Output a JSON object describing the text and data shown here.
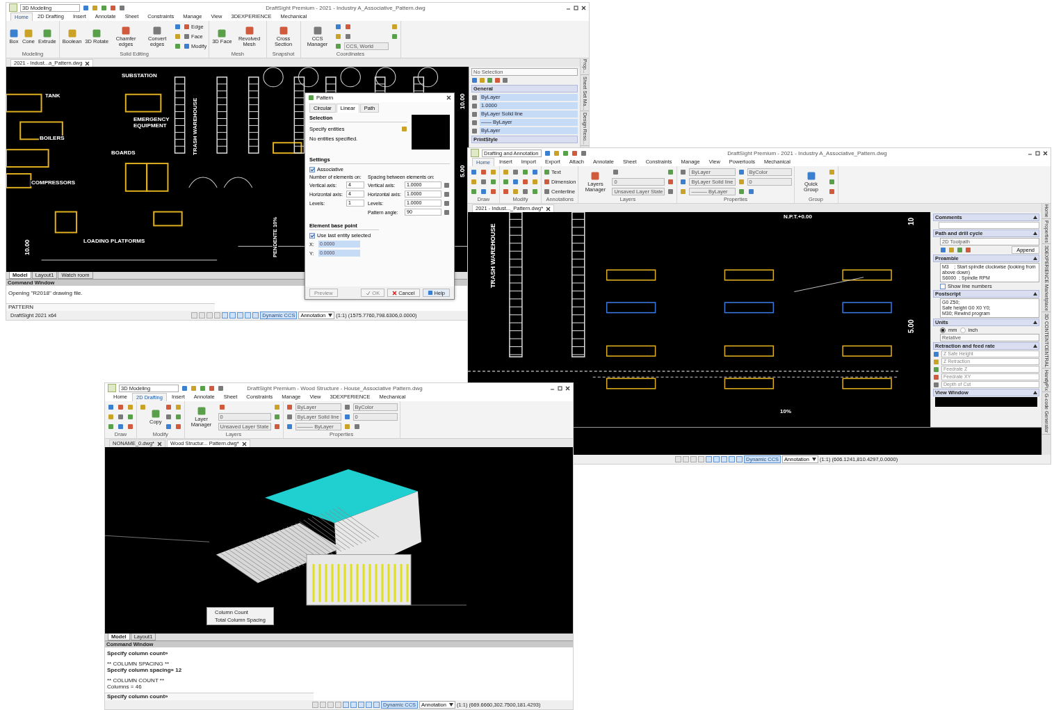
{
  "windows": [
    {
      "title": "DraftSight Premium - 2021 - Industry A_Associative_Pattern.dwg",
      "workspace": "3D Modeling",
      "menu_tabs": [
        {
          "label": "Home",
          "selected": true
        },
        {
          "label": "2D Drafting",
          "selected": false
        },
        {
          "label": "Insert",
          "selected": false
        },
        {
          "label": "Annotate",
          "selected": false
        },
        {
          "label": "Sheet",
          "selected": false
        },
        {
          "label": "Constraints",
          "selected": false
        },
        {
          "label": "Manage",
          "selected": false
        },
        {
          "label": "View",
          "selected": false
        },
        {
          "label": "3DEXPERIENCE",
          "selected": false
        },
        {
          "label": "Mechanical",
          "selected": false
        }
      ],
      "ribbon_groups": [
        {
          "label": "Modeling",
          "items": [
            {
              "kind": "big",
              "label": "Box"
            },
            {
              "kind": "big",
              "label": "Cone"
            },
            {
              "kind": "big",
              "label": "Extrude"
            }
          ]
        },
        {
          "label": "Solid Editing",
          "items": [
            {
              "kind": "big",
              "label": "Boolean"
            },
            {
              "kind": "big",
              "label": "3D Rotate"
            },
            {
              "kind": "big",
              "label": "Chamfer edges"
            },
            {
              "kind": "big",
              "label": "Convert edges"
            },
            {
              "kind": "icon"
            },
            {
              "kind": "icon"
            },
            {
              "kind": "icon"
            },
            {
              "kind": "small",
              "label": "Edge"
            },
            {
              "kind": "small",
              "label": "Face"
            },
            {
              "kind": "small",
              "label": "Modify"
            }
          ]
        },
        {
          "label": "Mesh",
          "items": [
            {
              "kind": "big",
              "label": "3D Face"
            },
            {
              "kind": "big",
              "label": "Revolved Mesh"
            }
          ]
        },
        {
          "label": "Snapshot",
          "items": [
            {
              "kind": "big",
              "label": "Cross Section"
            }
          ]
        },
        {
          "label": "Coordinates",
          "items": [
            {
              "kind": "big",
              "label": "CCS Manager"
            },
            {
              "kind": "icon"
            },
            {
              "kind": "icon"
            },
            {
              "kind": "icon"
            },
            {
              "kind": "icon"
            },
            {
              "kind": "icon"
            },
            {
              "kind": "field",
              "value": "CCS, World"
            },
            {
              "kind": "icon"
            },
            {
              "kind": "icon"
            }
          ]
        }
      ],
      "doc_tabs": [
        {
          "label": "2021 - Indust...a_Pattern.dwg",
          "selected": true
        }
      ],
      "canvas_labels": [
        "SUBSTATION",
        "TANK",
        "EMERGENCY EQUIPMENT",
        "BOILERS",
        "BOARDS",
        "TRASH WAREHOUSE",
        "COMPRESSORS",
        "LOADING PLATFORMS",
        "10.00",
        "5.00",
        "10.00",
        "PENDENTE 10%"
      ],
      "layout_tabs": [
        {
          "label": "Model",
          "selected": true
        },
        {
          "label": "Layout1",
          "selected": false
        },
        {
          "label": "Watch room",
          "selected": false
        }
      ],
      "panel": {
        "kind": "properties",
        "selector": "No Selection",
        "section": "General",
        "rows": [
          "ByLayer",
          "1.0000",
          "ByLayer    Solid line",
          "—— ByLayer",
          "ByLayer"
        ],
        "footer": "PrintStyle"
      },
      "side_tabs": [
        "Prop...",
        "Sheet Set Ma...",
        "Design Reso..."
      ],
      "command": {
        "title": "Command Window",
        "lines": [
          {
            "kind": "info",
            "text": "Opening \"R2018\" drawing file."
          }
        ],
        "input": "PATTERN"
      },
      "status": {
        "app": "DraftSight 2021 x64",
        "ccs": "Dynamic CCS",
        "annotation": "Annotation",
        "coords": "(1:1) (1575.7760,798.6306,0.0000)"
      }
    },
    {
      "title": "DraftSight Premium - 2021 - Industry A_Associative_Pattern.dwg",
      "workspace": "Drafting and Annotation",
      "menu_tabs": [
        {
          "label": "Home",
          "selected": true
        },
        {
          "label": "Insert",
          "selected": false
        },
        {
          "label": "Import",
          "selected": false
        },
        {
          "label": "Export",
          "selected": false
        },
        {
          "label": "Attach",
          "selected": false
        },
        {
          "label": "Annotate",
          "selected": false
        },
        {
          "label": "Sheet",
          "selected": false
        },
        {
          "label": "Constraints",
          "selected": false
        },
        {
          "label": "Manage",
          "selected": false
        },
        {
          "label": "View",
          "selected": false
        },
        {
          "label": "Powertools",
          "selected": false
        },
        {
          "label": "Mechanical",
          "selected": false
        }
      ],
      "ribbon_groups": [
        {
          "label": "Draw",
          "items": [
            {
              "kind": "icon"
            },
            {
              "kind": "icon"
            },
            {
              "kind": "icon"
            },
            {
              "kind": "icon"
            },
            {
              "kind": "icon"
            },
            {
              "kind": "icon"
            },
            {
              "kind": "icon"
            },
            {
              "kind": "icon"
            },
            {
              "kind": "icon"
            }
          ]
        },
        {
          "label": "Modify",
          "items": [
            {
              "kind": "icon"
            },
            {
              "kind": "icon"
            },
            {
              "kind": "icon"
            },
            {
              "kind": "icon"
            },
            {
              "kind": "icon"
            },
            {
              "kind": "icon"
            },
            {
              "kind": "icon"
            },
            {
              "kind": "icon"
            },
            {
              "kind": "icon"
            },
            {
              "kind": "icon"
            },
            {
              "kind": "icon"
            },
            {
              "kind": "icon"
            }
          ]
        },
        {
          "label": "Annotations",
          "items": [
            {
              "kind": "small",
              "label": "Text"
            },
            {
              "kind": "small",
              "label": "Dimension"
            },
            {
              "kind": "small",
              "label": "Centerline"
            }
          ]
        },
        {
          "label": "Layers",
          "items": [
            {
              "kind": "big",
              "label": "Layers Manager"
            },
            {
              "kind": "icon"
            },
            {
              "kind": "field",
              "value": "0"
            },
            {
              "kind": "field",
              "value": "Unsaved Layer State"
            },
            {
              "kind": "icon"
            },
            {
              "kind": "icon"
            },
            {
              "kind": "icon"
            }
          ]
        },
        {
          "label": "Properties",
          "items": [
            {
              "kind": "icon"
            },
            {
              "kind": "icon"
            },
            {
              "kind": "icon"
            },
            {
              "kind": "field",
              "value": "ByLayer"
            },
            {
              "kind": "field",
              "value": "ByLayer    Solid line"
            },
            {
              "kind": "field",
              "value": "——— ByLayer"
            },
            {
              "kind": "icon"
            },
            {
              "kind": "icon"
            },
            {
              "kind": "icon"
            },
            {
              "kind": "field",
              "value": "ByColor"
            },
            {
              "kind": "field",
              "value": "0"
            },
            {
              "kind": "icon"
            }
          ]
        },
        {
          "label": "Group",
          "items": [
            {
              "kind": "big",
              "label": "Quick Group"
            },
            {
              "kind": "icon"
            },
            {
              "kind": "icon"
            },
            {
              "kind": "icon"
            }
          ]
        }
      ],
      "doc_tabs": [
        {
          "label": "2021 - Indust..._Pattern.dwg*",
          "selected": true
        }
      ],
      "canvas_labels": [
        "TRASH WAREHOUSE",
        "N.P.T.+0.00",
        "10",
        "5.00",
        "10%"
      ],
      "panel": {
        "kind": "gcode",
        "sections": [
          {
            "kind": "text",
            "title": "Comments"
          },
          {
            "kind": "path",
            "title": "Path and drill cycle",
            "value": "2D Toolpath",
            "button": "Append"
          },
          {
            "kind": "script",
            "title": "Preamble",
            "lines": [
              "M3    ; Start spindle clockwise (looking from above down)",
              "S6000  ; Spindle RPM"
            ],
            "option": {
              "label": "Show line numbers",
              "checked": false
            }
          },
          {
            "kind": "script",
            "title": "Postscript",
            "lines": [
              "G0 Z50;",
              "Safe height G0 X0 Y0;",
              "M30; Rewind program"
            ]
          },
          {
            "kind": "units",
            "title": "Units",
            "options": [
              {
                "label": "mm",
                "selected": true
              },
              {
                "label": "inch",
                "selected": false
              }
            ],
            "value": "Relative"
          },
          {
            "kind": "fields",
            "title": "Retraction and feed rate",
            "placeholders": [
              "Z Safe Height",
              "Z Retraction",
              "Feedrate Z",
              "Feedrate XY",
              "Depth of Cut"
            ]
          },
          {
            "kind": "view",
            "title": "View Window"
          }
        ]
      },
      "side_tabs": [
        "Home",
        "Properties",
        "3DEXPERIENCE Marketplace",
        "3D CONTENTCENTRAL",
        "HandyPix",
        "G-code Generator"
      ],
      "status": {
        "ccs": "Dynamic CCS",
        "annotation": "Annotation",
        "coords": "(1:1) (606.1241,810.4297,0.0000)"
      }
    },
    {
      "title": "DraftSight Premium - Wood Structure - House_Associative Pattern.dwg",
      "workspace": "3D Modeling",
      "menu_tabs": [
        {
          "label": "Home",
          "selected": false
        },
        {
          "label": "2D Drafting",
          "selected": true
        },
        {
          "label": "Insert",
          "selected": false
        },
        {
          "label": "Annotate",
          "selected": false
        },
        {
          "label": "Sheet",
          "selected": false
        },
        {
          "label": "Constraints",
          "selected": false
        },
        {
          "label": "Manage",
          "selected": false
        },
        {
          "label": "View",
          "selected": false
        },
        {
          "label": "3DEXPERIENCE",
          "selected": false
        },
        {
          "label": "Mechanical",
          "selected": false
        }
      ],
      "ribbon_groups": [
        {
          "label": "Draw",
          "items": [
            {
              "kind": "icon"
            },
            {
              "kind": "icon"
            },
            {
              "kind": "icon"
            },
            {
              "kind": "icon"
            },
            {
              "kind": "icon"
            },
            {
              "kind": "icon"
            },
            {
              "kind": "icon"
            },
            {
              "kind": "icon"
            },
            {
              "kind": "icon"
            }
          ]
        },
        {
          "label": "Modify",
          "items": [
            {
              "kind": "icon"
            },
            {
              "kind": "big",
              "label": "Copy"
            },
            {
              "kind": "icon"
            },
            {
              "kind": "icon"
            },
            {
              "kind": "icon"
            },
            {
              "kind": "icon"
            },
            {
              "kind": "icon"
            },
            {
              "kind": "icon"
            }
          ]
        },
        {
          "label": "Layers",
          "items": [
            {
              "kind": "big",
              "label": "Layer Manager"
            },
            {
              "kind": "icon"
            },
            {
              "kind": "field",
              "value": "0"
            },
            {
              "kind": "field",
              "value": "Unsaved Layer State"
            },
            {
              "kind": "icon"
            },
            {
              "kind": "icon"
            },
            {
              "kind": "icon"
            }
          ]
        },
        {
          "label": "Properties",
          "items": [
            {
              "kind": "icon"
            },
            {
              "kind": "icon"
            },
            {
              "kind": "icon"
            },
            {
              "kind": "field",
              "value": "ByLayer"
            },
            {
              "kind": "field",
              "value": "ByLayer    Solid line"
            },
            {
              "kind": "field",
              "value": "——— ByLayer"
            },
            {
              "kind": "icon"
            },
            {
              "kind": "icon"
            },
            {
              "kind": "icon"
            },
            {
              "kind": "field",
              "value": "ByColor"
            },
            {
              "kind": "field",
              "value": "0"
            },
            {
              "kind": "icon"
            }
          ]
        }
      ],
      "doc_tabs": [
        {
          "label": "NONAME_0.dwg*",
          "selected": false
        },
        {
          "label": "Wood Structur... Pattern.dwg*",
          "selected": true
        }
      ],
      "context_menu": [
        "Column Count",
        "Total Column Spacing"
      ],
      "layout_tabs": [
        {
          "label": "Model",
          "selected": true
        },
        {
          "label": "Layout1",
          "selected": false
        }
      ],
      "command": {
        "title": "Command Window",
        "lines": [
          {
            "kind": "prompt",
            "text": "Specify column count»"
          },
          {
            "kind": "gap"
          },
          {
            "kind": "info",
            "text": "** COLUMN SPACING **"
          },
          {
            "kind": "prompt",
            "text": "Specify column spacing» 12"
          },
          {
            "kind": "gap"
          },
          {
            "kind": "info",
            "text": "** COLUMN COUNT **"
          },
          {
            "kind": "info",
            "text": "Columns = 46"
          }
        ],
        "input": "Specify column count»"
      },
      "status": {
        "ccs": "Dynamic CCS",
        "annotation": "Annotation",
        "coords": "(1:1) (669.6660,302.7500,181.4293)"
      }
    }
  ],
  "dialog": {
    "title": "Pattern",
    "tabs": [
      {
        "label": "Circular",
        "selected": false
      },
      {
        "label": "Linear",
        "selected": true
      },
      {
        "label": "Path",
        "selected": false
      }
    ],
    "selection_title": "Selection",
    "specify": "Specify entities",
    "none": "No entities specified.",
    "settings_title": "Settings",
    "associative": {
      "label": "Associative",
      "checked": true
    },
    "count_title": "Number of elements on:",
    "counts": [
      {
        "label": "Vertical axis:",
        "value": "4"
      },
      {
        "label": "Horizontal axis:",
        "value": "4"
      },
      {
        "label": "Levels:",
        "value": "1"
      }
    ],
    "spacing_title": "Spacing between elements on:",
    "spacings": [
      {
        "label": "Vertical axis:",
        "value": "1.0000"
      },
      {
        "label": "Horizontal axis:",
        "value": "1.0000"
      },
      {
        "label": "Levels:",
        "value": "1.0000"
      },
      {
        "label": "Pattern angle:",
        "value": "90"
      }
    ],
    "base_title": "Element base point",
    "use_last": {
      "label": "Use last entity selected",
      "checked": true
    },
    "base": [
      {
        "label": "X:",
        "value": "0.0000"
      },
      {
        "label": "Y:",
        "value": "0.0000"
      }
    ],
    "buttons": [
      {
        "kind": "preview",
        "label": "Preview"
      },
      {
        "kind": "ok",
        "label": "OK"
      },
      {
        "kind": "cancel",
        "label": "Cancel"
      },
      {
        "kind": "help",
        "label": "Help"
      }
    ]
  }
}
